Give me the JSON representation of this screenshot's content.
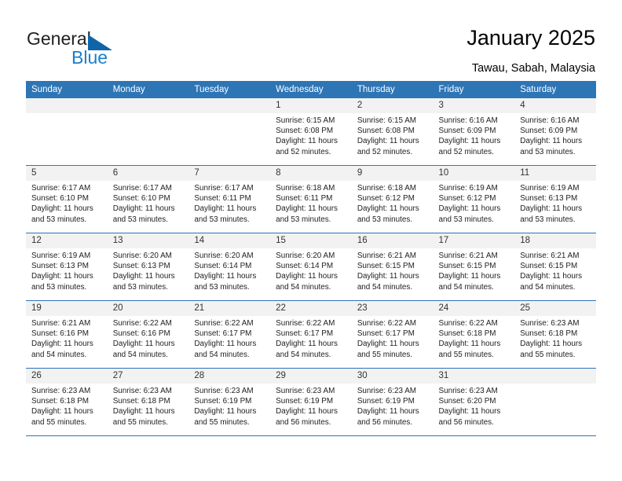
{
  "brand": {
    "name_top": "General",
    "name_bottom": "Blue",
    "triangle_color": "#1064a8",
    "blue_text_color": "#1b7fcb"
  },
  "header": {
    "title": "January 2025",
    "subtitle": "Tawau, Sabah, Malaysia"
  },
  "theme": {
    "header_bg": "#2e75b6",
    "header_text": "#ffffff",
    "daynum_bg": "#f2f2f2",
    "row_rule": "#2e75b6"
  },
  "weekdays": [
    "Sunday",
    "Monday",
    "Tuesday",
    "Wednesday",
    "Thursday",
    "Friday",
    "Saturday"
  ],
  "weeks": [
    [
      {
        "day": "",
        "l1": "",
        "l2": "",
        "l3": "",
        "l4": ""
      },
      {
        "day": "",
        "l1": "",
        "l2": "",
        "l3": "",
        "l4": ""
      },
      {
        "day": "",
        "l1": "",
        "l2": "",
        "l3": "",
        "l4": ""
      },
      {
        "day": "1",
        "l1": "Sunrise: 6:15 AM",
        "l2": "Sunset: 6:08 PM",
        "l3": "Daylight: 11 hours",
        "l4": "and 52 minutes."
      },
      {
        "day": "2",
        "l1": "Sunrise: 6:15 AM",
        "l2": "Sunset: 6:08 PM",
        "l3": "Daylight: 11 hours",
        "l4": "and 52 minutes."
      },
      {
        "day": "3",
        "l1": "Sunrise: 6:16 AM",
        "l2": "Sunset: 6:09 PM",
        "l3": "Daylight: 11 hours",
        "l4": "and 52 minutes."
      },
      {
        "day": "4",
        "l1": "Sunrise: 6:16 AM",
        "l2": "Sunset: 6:09 PM",
        "l3": "Daylight: 11 hours",
        "l4": "and 53 minutes."
      }
    ],
    [
      {
        "day": "5",
        "l1": "Sunrise: 6:17 AM",
        "l2": "Sunset: 6:10 PM",
        "l3": "Daylight: 11 hours",
        "l4": "and 53 minutes."
      },
      {
        "day": "6",
        "l1": "Sunrise: 6:17 AM",
        "l2": "Sunset: 6:10 PM",
        "l3": "Daylight: 11 hours",
        "l4": "and 53 minutes."
      },
      {
        "day": "7",
        "l1": "Sunrise: 6:17 AM",
        "l2": "Sunset: 6:11 PM",
        "l3": "Daylight: 11 hours",
        "l4": "and 53 minutes."
      },
      {
        "day": "8",
        "l1": "Sunrise: 6:18 AM",
        "l2": "Sunset: 6:11 PM",
        "l3": "Daylight: 11 hours",
        "l4": "and 53 minutes."
      },
      {
        "day": "9",
        "l1": "Sunrise: 6:18 AM",
        "l2": "Sunset: 6:12 PM",
        "l3": "Daylight: 11 hours",
        "l4": "and 53 minutes."
      },
      {
        "day": "10",
        "l1": "Sunrise: 6:19 AM",
        "l2": "Sunset: 6:12 PM",
        "l3": "Daylight: 11 hours",
        "l4": "and 53 minutes."
      },
      {
        "day": "11",
        "l1": "Sunrise: 6:19 AM",
        "l2": "Sunset: 6:13 PM",
        "l3": "Daylight: 11 hours",
        "l4": "and 53 minutes."
      }
    ],
    [
      {
        "day": "12",
        "l1": "Sunrise: 6:19 AM",
        "l2": "Sunset: 6:13 PM",
        "l3": "Daylight: 11 hours",
        "l4": "and 53 minutes."
      },
      {
        "day": "13",
        "l1": "Sunrise: 6:20 AM",
        "l2": "Sunset: 6:13 PM",
        "l3": "Daylight: 11 hours",
        "l4": "and 53 minutes."
      },
      {
        "day": "14",
        "l1": "Sunrise: 6:20 AM",
        "l2": "Sunset: 6:14 PM",
        "l3": "Daylight: 11 hours",
        "l4": "and 53 minutes."
      },
      {
        "day": "15",
        "l1": "Sunrise: 6:20 AM",
        "l2": "Sunset: 6:14 PM",
        "l3": "Daylight: 11 hours",
        "l4": "and 54 minutes."
      },
      {
        "day": "16",
        "l1": "Sunrise: 6:21 AM",
        "l2": "Sunset: 6:15 PM",
        "l3": "Daylight: 11 hours",
        "l4": "and 54 minutes."
      },
      {
        "day": "17",
        "l1": "Sunrise: 6:21 AM",
        "l2": "Sunset: 6:15 PM",
        "l3": "Daylight: 11 hours",
        "l4": "and 54 minutes."
      },
      {
        "day": "18",
        "l1": "Sunrise: 6:21 AM",
        "l2": "Sunset: 6:15 PM",
        "l3": "Daylight: 11 hours",
        "l4": "and 54 minutes."
      }
    ],
    [
      {
        "day": "19",
        "l1": "Sunrise: 6:21 AM",
        "l2": "Sunset: 6:16 PM",
        "l3": "Daylight: 11 hours",
        "l4": "and 54 minutes."
      },
      {
        "day": "20",
        "l1": "Sunrise: 6:22 AM",
        "l2": "Sunset: 6:16 PM",
        "l3": "Daylight: 11 hours",
        "l4": "and 54 minutes."
      },
      {
        "day": "21",
        "l1": "Sunrise: 6:22 AM",
        "l2": "Sunset: 6:17 PM",
        "l3": "Daylight: 11 hours",
        "l4": "and 54 minutes."
      },
      {
        "day": "22",
        "l1": "Sunrise: 6:22 AM",
        "l2": "Sunset: 6:17 PM",
        "l3": "Daylight: 11 hours",
        "l4": "and 54 minutes."
      },
      {
        "day": "23",
        "l1": "Sunrise: 6:22 AM",
        "l2": "Sunset: 6:17 PM",
        "l3": "Daylight: 11 hours",
        "l4": "and 55 minutes."
      },
      {
        "day": "24",
        "l1": "Sunrise: 6:22 AM",
        "l2": "Sunset: 6:18 PM",
        "l3": "Daylight: 11 hours",
        "l4": "and 55 minutes."
      },
      {
        "day": "25",
        "l1": "Sunrise: 6:23 AM",
        "l2": "Sunset: 6:18 PM",
        "l3": "Daylight: 11 hours",
        "l4": "and 55 minutes."
      }
    ],
    [
      {
        "day": "26",
        "l1": "Sunrise: 6:23 AM",
        "l2": "Sunset: 6:18 PM",
        "l3": "Daylight: 11 hours",
        "l4": "and 55 minutes."
      },
      {
        "day": "27",
        "l1": "Sunrise: 6:23 AM",
        "l2": "Sunset: 6:18 PM",
        "l3": "Daylight: 11 hours",
        "l4": "and 55 minutes."
      },
      {
        "day": "28",
        "l1": "Sunrise: 6:23 AM",
        "l2": "Sunset: 6:19 PM",
        "l3": "Daylight: 11 hours",
        "l4": "and 55 minutes."
      },
      {
        "day": "29",
        "l1": "Sunrise: 6:23 AM",
        "l2": "Sunset: 6:19 PM",
        "l3": "Daylight: 11 hours",
        "l4": "and 56 minutes."
      },
      {
        "day": "30",
        "l1": "Sunrise: 6:23 AM",
        "l2": "Sunset: 6:19 PM",
        "l3": "Daylight: 11 hours",
        "l4": "and 56 minutes."
      },
      {
        "day": "31",
        "l1": "Sunrise: 6:23 AM",
        "l2": "Sunset: 6:20 PM",
        "l3": "Daylight: 11 hours",
        "l4": "and 56 minutes."
      },
      {
        "day": "",
        "l1": "",
        "l2": "",
        "l3": "",
        "l4": ""
      }
    ]
  ]
}
